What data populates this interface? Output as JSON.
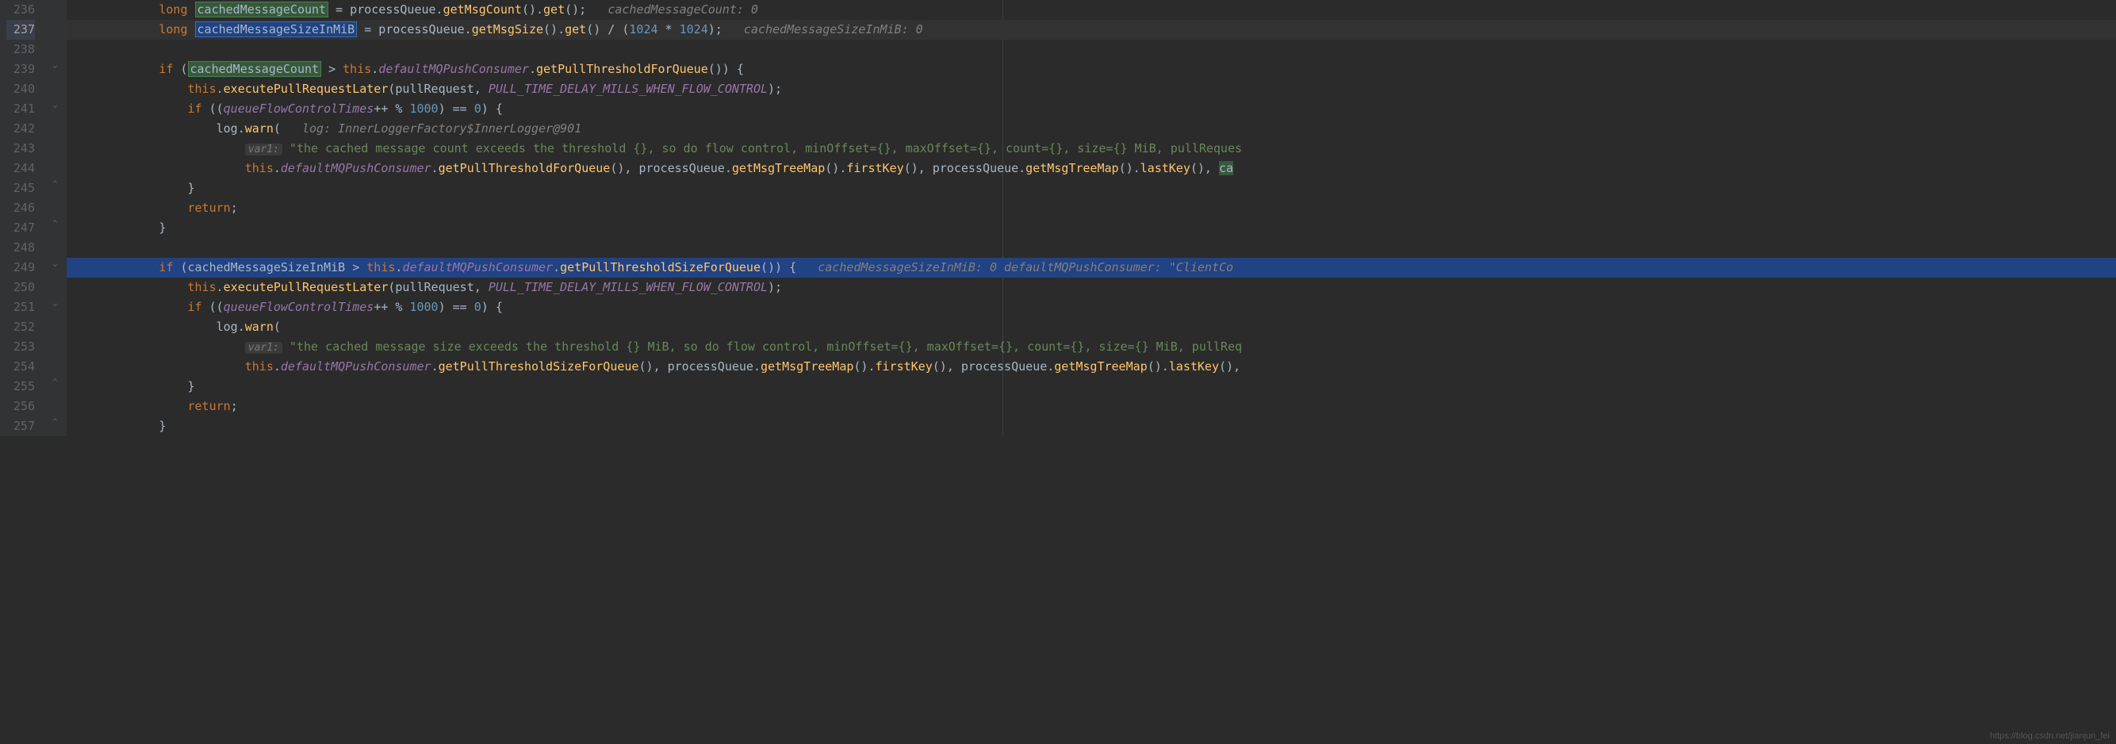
{
  "watermark": "https://blog.csdn.net/jianjun_fei",
  "lines": {
    "start": 236,
    "end": 257,
    "current": 237,
    "highlighted": 249
  },
  "code": {
    "l236": {
      "kw": "long",
      "var": "cachedMessageCount",
      "rest1": " = processQueue.",
      "fn1": "getMsgCount",
      "rest2": "().",
      "fn2": "get",
      "rest3": "();",
      "hint": "cachedMessageCount: 0"
    },
    "l237": {
      "kw": "long",
      "var": "cachedMessageSizeInMiB",
      "rest1": " = processQueue.",
      "fn1": "getMsgSize",
      "rest2": "().",
      "fn2": "get",
      "rest3": "() / (",
      "n1": "1024",
      "op": " * ",
      "n2": "1024",
      "rest4": ");",
      "hint": "cachedMessageSizeInMiB: 0"
    },
    "l239": {
      "kw": "if",
      "p1": " (",
      "var": "cachedMessageCount",
      "p2": " > ",
      "kw2": "this",
      "dot": ".",
      "fld": "defaultMQPushConsumer",
      "dot2": ".",
      "fn": "getPullThresholdForQueue",
      "p3": "()) {"
    },
    "l240": {
      "kw": "this",
      "dot": ".",
      "fn": "executePullRequestLater",
      "p1": "(pullRequest, ",
      "const": "PULL_TIME_DELAY_MILLS_WHEN_FLOW_CONTROL",
      "p2": ");"
    },
    "l241": {
      "kw": "if",
      "p1": " ((",
      "fld": "queueFlowControlTimes",
      "p2": "++ % ",
      "num": "1000",
      "p3": ") == ",
      "num2": "0",
      "p4": ") {"
    },
    "l242": {
      "ident": "log",
      "dot": ".",
      "fn": "warn",
      "p1": "(",
      "hint": "log: InnerLoggerFactory$InnerLogger@901"
    },
    "l243": {
      "paramhint": "var1:",
      "str": "\"the cached message count exceeds the threshold {}, so do flow control, minOffset={}, maxOffset={}, count={}, size={} MiB, pullReques"
    },
    "l244": {
      "kw": "this",
      "dot": ".",
      "fld": "defaultMQPushConsumer",
      "dot2": ".",
      "fn": "getPullThresholdForQueue",
      "p1": "(), processQueue.",
      "fn2": "getMsgTreeMap",
      "p2": "().",
      "fn3": "firstKey",
      "p3": "(), processQueue.",
      "fn4": "getMsgTreeMap",
      "p4": "().",
      "fn5": "lastKey",
      "p5": "(), ",
      "var": "ca"
    },
    "l245": {
      "brace": "}"
    },
    "l246": {
      "kw": "return",
      "semi": ";"
    },
    "l247": {
      "brace": "}"
    },
    "l249": {
      "kw": "if",
      "p1": " (cachedMessageSizeInMiB > ",
      "kw2": "this",
      "dot": ".",
      "fld": "defaultMQPushConsumer",
      "dot2": ".",
      "fn": "getPullThresholdSizeForQueue",
      "p2": "()) {",
      "hint": "cachedMessageSizeInMiB: 0   defaultMQPushConsumer: \"ClientCo"
    },
    "l250": {
      "kw": "this",
      "dot": ".",
      "fn": "executePullRequestLater",
      "p1": "(pullRequest, ",
      "const": "PULL_TIME_DELAY_MILLS_WHEN_FLOW_CONTROL",
      "p2": ");"
    },
    "l251": {
      "kw": "if",
      "p1": " ((",
      "fld": "queueFlowControlTimes",
      "p2": "++ % ",
      "num": "1000",
      "p3": ") == ",
      "num2": "0",
      "p4": ") {"
    },
    "l252": {
      "ident": "log",
      "dot": ".",
      "fn": "warn",
      "p1": "("
    },
    "l253": {
      "paramhint": "var1:",
      "str": "\"the cached message size exceeds the threshold {} MiB, so do flow control, minOffset={}, maxOffset={}, count={}, size={} MiB, pullReq"
    },
    "l254": {
      "kw": "this",
      "dot": ".",
      "fld": "defaultMQPushConsumer",
      "dot2": ".",
      "fn": "getPullThresholdSizeForQueue",
      "p1": "(), processQueue.",
      "fn2": "getMsgTreeMap",
      "p2": "().",
      "fn3": "firstKey",
      "p3": "(), processQueue.",
      "fn4": "getMsgTreeMap",
      "p4": "().",
      "fn5": "lastKey",
      "p5": "(),"
    },
    "l255": {
      "brace": "}"
    },
    "l256": {
      "kw": "return",
      "semi": ";"
    },
    "l257": {
      "brace": "}"
    }
  }
}
